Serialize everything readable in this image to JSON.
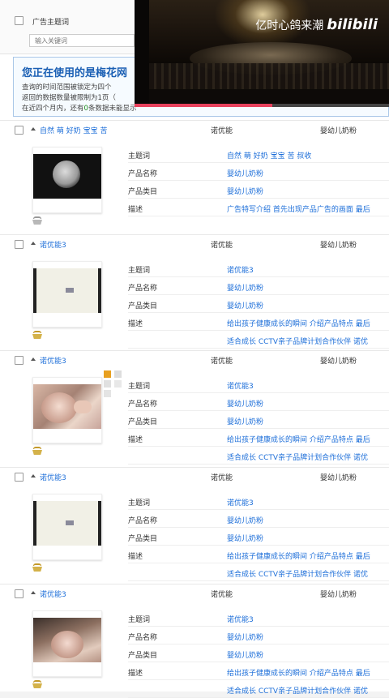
{
  "header": {
    "keyword_col_label": "广告主题词",
    "keyword_placeholder": "输入关键词"
  },
  "notice": {
    "title": "您正在使用的是梅花网",
    "line1": "查询的时间范围被锁定为四个",
    "line2": "返回的数据数量被限制为1页（",
    "line3_prefix": "在近四个月内，还有",
    "line3_count": "0",
    "line3_suffix": "条数据未能显示"
  },
  "video": {
    "caption": "亿时心鸽来潮",
    "logo": "bilibili",
    "progress": 0.54
  },
  "ads": [
    {
      "keyword": "自然 萌 好奶 宝宝 苦",
      "brand": "诺优能",
      "category": "婴幼儿奶粉",
      "thumb": "dark",
      "rows": [
        {
          "label": "主题词",
          "value": "自然 萌 好奶 宝宝 苦 叔收"
        },
        {
          "label": "产品名称",
          "value": "婴幼儿奶粉"
        },
        {
          "label": "产品类目",
          "value": "婴幼儿奶粉"
        },
        {
          "label": "描述",
          "value": "广告特写介绍 首先出现产品广告的画面 最后"
        }
      ]
    },
    {
      "keyword": "诺优能3",
      "brand": "诺优能",
      "category": "婴幼儿奶粉",
      "thumb": "pale",
      "rows": [
        {
          "label": "主题词",
          "value": "诺优能3"
        },
        {
          "label": "产品名称",
          "value": "婴幼儿奶粉"
        },
        {
          "label": "产品类目",
          "value": "婴幼儿奶粉"
        },
        {
          "label": "描述",
          "value": "给出孩子健康成长的瞬间 介绍产品特点 最后"
        },
        {
          "label": "",
          "value": "适合成长 CCTV亲子品牌计划合作伙伴 诺优"
        }
      ]
    },
    {
      "keyword": "诺优能3",
      "brand": "诺优能",
      "category": "婴幼儿奶粉",
      "thumb": "baby",
      "rows": [
        {
          "label": "主题词",
          "value": "诺优能3"
        },
        {
          "label": "产品名称",
          "value": "婴幼儿奶粉"
        },
        {
          "label": "产品类目",
          "value": "婴幼儿奶粉"
        },
        {
          "label": "描述",
          "value": "给出孩子健康成长的瞬间 介绍产品特点 最后"
        },
        {
          "label": "",
          "value": "适合成长 CCTV亲子品牌计划合作伙伴 诺优"
        }
      ]
    },
    {
      "keyword": "诺优能3",
      "brand": "诺优能",
      "category": "婴幼儿奶粉",
      "thumb": "pale",
      "rows": [
        {
          "label": "主题词",
          "value": "诺优能3"
        },
        {
          "label": "产品名称",
          "value": "婴幼儿奶粉"
        },
        {
          "label": "产品类目",
          "value": "婴幼儿奶粉"
        },
        {
          "label": "描述",
          "value": "给出孩子健康成长的瞬间 介绍产品特点 最后"
        },
        {
          "label": "",
          "value": "适合成长 CCTV亲子品牌计划合作伙伴 诺优"
        }
      ]
    },
    {
      "keyword": "诺优能3",
      "brand": "诺优能",
      "category": "婴幼儿奶粉",
      "thumb": "baby2",
      "rows": [
        {
          "label": "主题词",
          "value": "诺优能3"
        },
        {
          "label": "产品名称",
          "value": "婴幼儿奶粉"
        },
        {
          "label": "产品类目",
          "value": "婴幼儿奶粉"
        },
        {
          "label": "描述",
          "value": "给出孩子健康成长的瞬间 介绍产品特点 最后"
        },
        {
          "label": "",
          "value": "适合成长 CCTV亲子品牌计划合作伙伴 诺优"
        }
      ]
    }
  ],
  "icons": {
    "collapse": "collapse-triangle-icon",
    "favorite": "basket-icon"
  },
  "colors": {
    "link": "#1e6fd9",
    "notice_title": "#1a5fb4",
    "count": "#1a8a1a",
    "bilibili_progress": "#e8415d"
  }
}
